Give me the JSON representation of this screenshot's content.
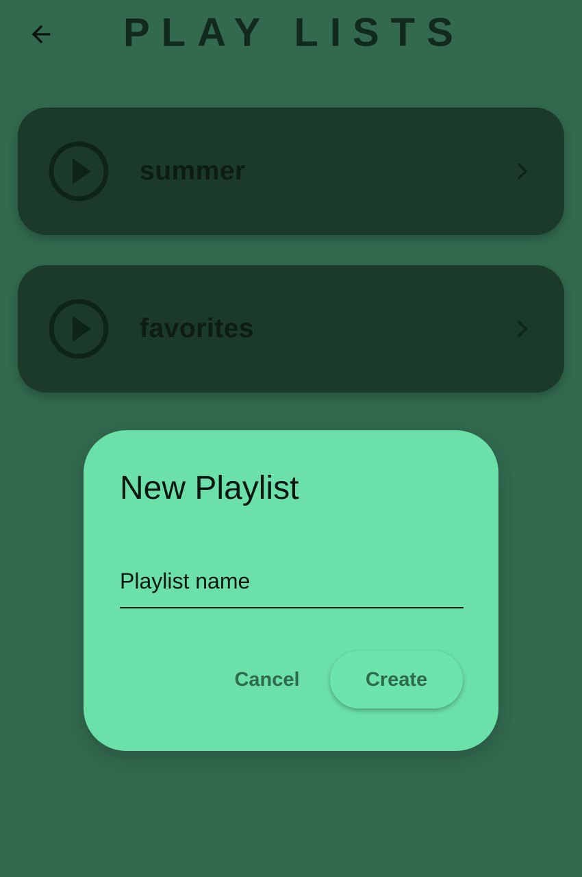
{
  "header": {
    "back_icon": "arrow-left-icon",
    "title": "PLAY LISTS"
  },
  "playlists": [
    {
      "name": "summer",
      "icon": "play-circle-icon",
      "trailing_icon": "chevron-right-icon"
    },
    {
      "name": "favorites",
      "icon": "play-circle-icon",
      "trailing_icon": "chevron-right-icon"
    }
  ],
  "dialog": {
    "title": "New Playlist",
    "name_field": {
      "placeholder": "Playlist name",
      "value": ""
    },
    "cancel_label": "Cancel",
    "create_label": "Create"
  },
  "colors": {
    "background": "#32694f",
    "card": "#1b3a2a",
    "dialog": "#6be0a8",
    "button_text": "#2f6a4e"
  }
}
